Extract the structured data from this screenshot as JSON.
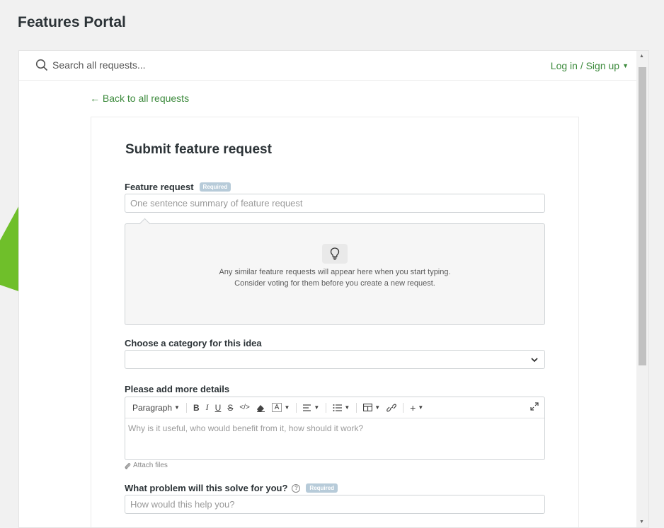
{
  "header": {
    "title": "Features Portal"
  },
  "topbar": {
    "search_placeholder": "Search all requests...",
    "login_label": "Log in / Sign up"
  },
  "nav": {
    "back_label": "Back to all requests"
  },
  "form": {
    "title": "Submit feature request",
    "feature_request": {
      "label": "Feature request",
      "required_badge": "Required",
      "placeholder": "One sentence summary of feature request",
      "value": ""
    },
    "similar": {
      "line1": "Any similar feature requests will appear here when you start typing.",
      "line2": "Consider voting for them before you create a new request."
    },
    "category": {
      "label": "Choose a category for this idea",
      "selected": ""
    },
    "details": {
      "label": "Please add more details",
      "toolbar": {
        "paragraph": "Paragraph",
        "bold": "B",
        "italic": "I",
        "underline": "U",
        "strike": "S",
        "code": "</>",
        "font_color": "A",
        "add": "+"
      },
      "placeholder": "Why is it useful, who would benefit from it, how should it work?",
      "attach_label": "Attach files"
    },
    "problem": {
      "label": "What problem will this solve for you?",
      "help_icon": "?",
      "required_badge": "Required",
      "placeholder": "How would this help you?"
    }
  },
  "colors": {
    "accent_green": "#3c8a3c",
    "required_badge": "#b7cbd9",
    "arrow_green": "#6fbf2a"
  }
}
